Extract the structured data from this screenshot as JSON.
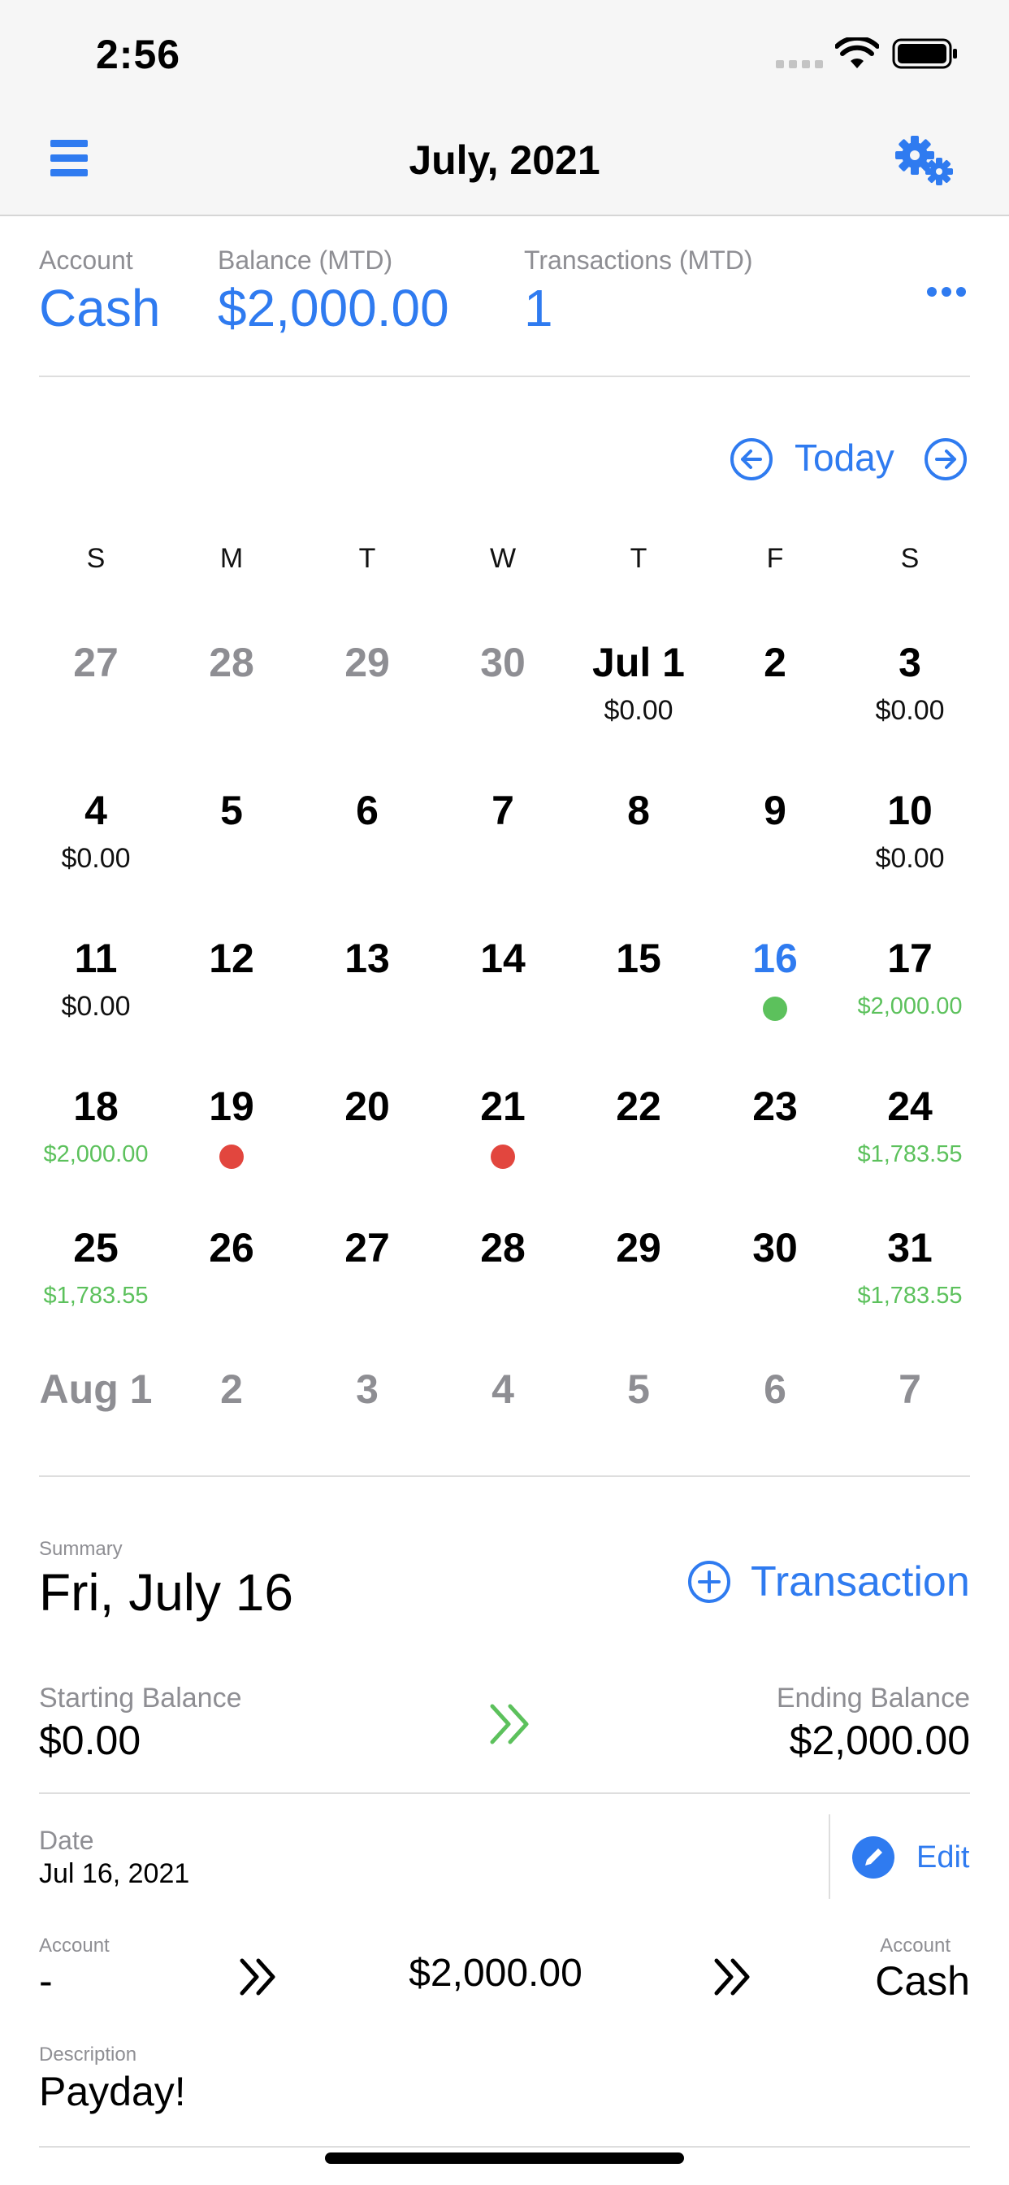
{
  "status_bar": {
    "time": "2:56"
  },
  "nav": {
    "title": "July, 2021",
    "menu_icon": "hamburger-menu-icon",
    "settings_icon": "gears-icon"
  },
  "stats": {
    "account_label": "Account",
    "account_value": "Cash",
    "balance_label": "Balance (MTD)",
    "balance_value": "$2,000.00",
    "transactions_label": "Transactions (MTD)",
    "transactions_value": "1",
    "more_icon": "ellipsis-icon"
  },
  "calendar": {
    "today_label": "Today",
    "weekdays": [
      "S",
      "M",
      "T",
      "W",
      "T",
      "F",
      "S"
    ],
    "weeks": [
      [
        {
          "n": "27",
          "m": true
        },
        {
          "n": "28",
          "m": true
        },
        {
          "n": "29",
          "m": true
        },
        {
          "n": "30",
          "m": true
        },
        {
          "n": "Jul 1",
          "b": "$0.00"
        },
        {
          "n": "2"
        },
        {
          "n": "3",
          "b": "$0.00"
        }
      ],
      [
        {
          "n": "4",
          "b": "$0.00"
        },
        {
          "n": "5"
        },
        {
          "n": "6"
        },
        {
          "n": "7"
        },
        {
          "n": "8"
        },
        {
          "n": "9"
        },
        {
          "n": "10",
          "b": "$0.00"
        }
      ],
      [
        {
          "n": "11",
          "b": "$0.00"
        },
        {
          "n": "12"
        },
        {
          "n": "13"
        },
        {
          "n": "14"
        },
        {
          "n": "15"
        },
        {
          "n": "16",
          "t": true,
          "dot": "green"
        },
        {
          "n": "17",
          "g": "$2,000.00"
        }
      ],
      [
        {
          "n": "18",
          "g": "$2,000.00"
        },
        {
          "n": "19",
          "dot": "red"
        },
        {
          "n": "20"
        },
        {
          "n": "21",
          "dot": "red"
        },
        {
          "n": "22"
        },
        {
          "n": "23"
        },
        {
          "n": "24",
          "g": "$1,783.55"
        }
      ],
      [
        {
          "n": "25",
          "g": "$1,783.55"
        },
        {
          "n": "26"
        },
        {
          "n": "27"
        },
        {
          "n": "28"
        },
        {
          "n": "29"
        },
        {
          "n": "30"
        },
        {
          "n": "31",
          "g": "$1,783.55"
        }
      ],
      [
        {
          "n": "Aug 1",
          "m": true
        },
        {
          "n": "2",
          "m": true
        },
        {
          "n": "3",
          "m": true
        },
        {
          "n": "4",
          "m": true
        },
        {
          "n": "5",
          "m": true
        },
        {
          "n": "6",
          "m": true
        },
        {
          "n": "7",
          "m": true
        }
      ]
    ]
  },
  "summary": {
    "label": "Summary",
    "date": "Fri, July 16",
    "add_transaction_label": "Transaction",
    "starting_label": "Starting Balance",
    "starting_value": "$0.00",
    "ending_label": "Ending Balance",
    "ending_value": "$2,000.00"
  },
  "transaction": {
    "date_label": "Date",
    "date_value": "Jul 16, 2021",
    "edit_label": "Edit",
    "from_account_label": "Account",
    "from_account_value": "-",
    "amount": "$2,000.00",
    "to_account_label": "Account",
    "to_account_value": "Cash",
    "description_label": "Description",
    "description_value": "Payday!"
  },
  "colors": {
    "accent": "#2f7bf0",
    "positive": "#5cc15c",
    "negative": "#e2463e",
    "muted": "#8e8e93"
  }
}
